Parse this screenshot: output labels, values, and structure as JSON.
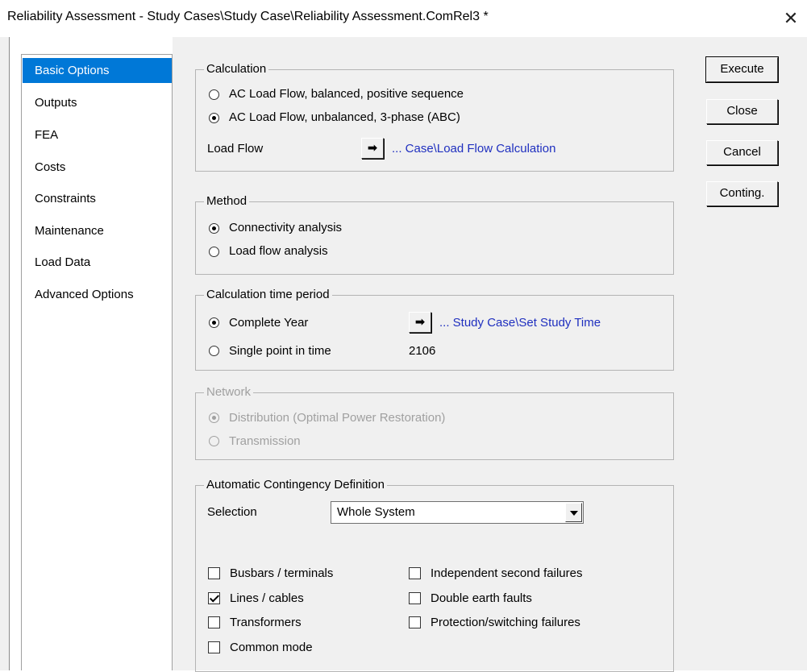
{
  "window": {
    "title": "Reliability Assessment - Study Cases\\Study Case\\Reliability Assessment.ComRel3 *",
    "close_glyph": "✕"
  },
  "sidebar": {
    "items": [
      {
        "label": "Basic Options",
        "selected": true
      },
      {
        "label": "Outputs"
      },
      {
        "label": "FEA"
      },
      {
        "label": "Costs"
      },
      {
        "label": "Constraints"
      },
      {
        "label": "Maintenance"
      },
      {
        "label": "Load Data"
      },
      {
        "label": "Advanced Options"
      }
    ]
  },
  "buttons": {
    "execute": "Execute",
    "close": "Close",
    "cancel": "Cancel",
    "conting": "Conting."
  },
  "calculation": {
    "legend": "Calculation",
    "option_balanced": "AC Load Flow, balanced, positive sequence",
    "option_unbalanced": "AC Load Flow, unbalanced, 3-phase (ABC)",
    "selected": "unbalanced",
    "load_flow_label": "Load Flow",
    "load_flow_link": "... Case\\Load Flow Calculation"
  },
  "method": {
    "legend": "Method",
    "option_connectivity": "Connectivity analysis",
    "option_load_flow": "Load flow analysis",
    "selected": "connectivity"
  },
  "time_period": {
    "legend": "Calculation time period",
    "option_complete_year": "Complete Year",
    "option_single_point": "Single point in time",
    "selected": "complete_year",
    "study_time_link": "... Study Case\\Set Study Time",
    "single_point_value": "2106"
  },
  "network": {
    "legend": "Network",
    "option_distribution": "Distribution (Optimal Power Restoration)",
    "option_transmission": "Transmission",
    "selected": "distribution",
    "enabled": false
  },
  "contingency": {
    "legend": "Automatic Contingency Definition",
    "selection_label": "Selection",
    "selection_value": "Whole System",
    "checkboxes": {
      "busbars": {
        "label": "Busbars / terminals",
        "checked": false
      },
      "lines": {
        "label": "Lines / cables",
        "checked": true
      },
      "transformers": {
        "label": "Transformers",
        "checked": false
      },
      "common_mode": {
        "label": "Common mode",
        "checked": false
      },
      "independent": {
        "label": "Independent second failures",
        "checked": false
      },
      "double_earth": {
        "label": "Double earth faults",
        "checked": false
      },
      "protection": {
        "label": "Protection/switching failures",
        "checked": false
      }
    }
  },
  "icons": {
    "arrow": "➡"
  }
}
